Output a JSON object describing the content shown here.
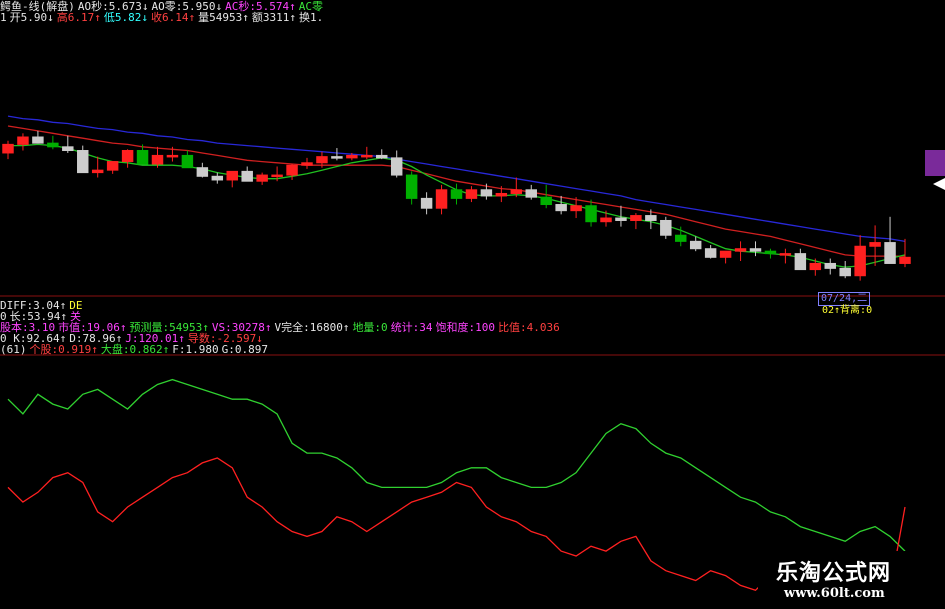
{
  "header": {
    "line1": [
      {
        "text": "鳄鱼-线(解盘)",
        "color": "#e6e6e6"
      },
      {
        "text": "AO秒:5.673↓",
        "color": "#e6e6e6"
      },
      {
        "text": "AO零:5.950↓",
        "color": "#e6e6e6"
      },
      {
        "text": "AC秒:5.574↑",
        "color": "#ff44ff"
      },
      {
        "text": "AC零",
        "color": "#39e639"
      }
    ],
    "line2": [
      {
        "text": "1",
        "color": "#e6e6e6"
      },
      {
        "text": "开5.90↓",
        "color": "#e6e6e6"
      },
      {
        "text": "高6.17↑",
        "color": "#ff4040"
      },
      {
        "text": "低5.82↓",
        "color": "#33ffff"
      },
      {
        "text": "收6.14↑",
        "color": "#ff4040"
      },
      {
        "text": "量54953↑",
        "color": "#e6e6e6"
      },
      {
        "text": "额3311↑",
        "color": "#e6e6e6"
      },
      {
        "text": "换1.",
        "color": "#e6e6e6"
      }
    ]
  },
  "indicators": {
    "line1": [
      {
        "text": "DIFF:3.04↑",
        "color": "#e6e6e6"
      },
      {
        "text": "DE",
        "color": "#ffff33"
      }
    ],
    "line2": [
      {
        "text": "0",
        "color": "#e6e6e6"
      },
      {
        "text": "长:53.94↑",
        "color": "#e6e6e6"
      },
      {
        "text": "关",
        "color": "#ff44ff"
      }
    ],
    "line3": [
      {
        "text": "股本:3.10",
        "color": "#ff44ff"
      },
      {
        "text": "市值:19.06↑",
        "color": "#ff44ff"
      },
      {
        "text": "预测量:54953↑",
        "color": "#39e639"
      },
      {
        "text": "VS:30278↑",
        "color": "#ff44ff"
      },
      {
        "text": "V完全:16800↑",
        "color": "#e6e6e6"
      },
      {
        "text": "地量:0",
        "color": "#39e639"
      },
      {
        "text": "统计:34",
        "color": "#ff44ff"
      },
      {
        "text": "饱和度:100",
        "color": "#ff44ff"
      },
      {
        "text": "比值:4.036",
        "color": "#ff4040"
      }
    ],
    "line4": [
      {
        "text": "0 K:92.64↑",
        "color": "#e6e6e6"
      },
      {
        "text": "D:78.96↑",
        "color": "#e6e6e6"
      },
      {
        "text": "J:120.01↑",
        "color": "#ff44ff"
      },
      {
        "text": "导数:-2.597↓",
        "color": "#ff4040"
      }
    ],
    "line5": [
      {
        "text": "(61)",
        "color": "#e6e6e6"
      },
      {
        "text": "个股:0.919↑",
        "color": "#ff4040"
      },
      {
        "text": "大盘:0.862↑",
        "color": "#39e639"
      },
      {
        "text": "F:1.980",
        "color": "#e6e6e6"
      },
      {
        "text": "G:0.897",
        "color": "#e6e6e6"
      }
    ]
  },
  "right_tags": {
    "date": "07/24,二",
    "divergence": "02↑背离:0"
  },
  "watermark": {
    "title": "乐淘公式网",
    "url": "www.60lt.com"
  },
  "colors": {
    "up": "#ff2020",
    "down_filled": "#00b000",
    "down_hollow": "#cccccc",
    "ma_blue": "#2828d8",
    "ma_red": "#d02020",
    "ma_green": "#20c020",
    "green_line": "#30d030",
    "red_line": "#ff2020"
  },
  "chart_data": [
    {
      "type": "candlestick",
      "index": [
        1,
        2,
        3,
        4,
        5,
        6,
        7,
        8,
        9,
        10,
        11,
        12,
        13,
        14,
        15,
        16,
        17,
        18,
        19,
        20,
        21,
        22,
        23,
        24,
        25,
        26,
        27,
        28,
        29,
        30,
        31,
        32,
        33,
        34,
        35,
        36,
        37,
        38,
        39,
        40,
        41,
        42,
        43,
        44,
        45,
        46,
        47,
        48,
        49,
        50,
        51,
        52,
        53,
        54,
        55,
        56,
        57,
        58,
        59,
        60,
        61
      ],
      "open": [
        6.9,
        6.97,
        7.03,
        6.98,
        6.95,
        6.92,
        6.74,
        6.76,
        6.83,
        6.92,
        6.81,
        6.88,
        6.88,
        6.78,
        6.71,
        6.68,
        6.75,
        6.67,
        6.72,
        6.72,
        6.8,
        6.82,
        6.87,
        6.86,
        6.88,
        6.88,
        6.86,
        6.72,
        6.53,
        6.45,
        6.6,
        6.53,
        6.6,
        6.55,
        6.57,
        6.6,
        6.54,
        6.48,
        6.43,
        6.47,
        6.34,
        6.37,
        6.35,
        6.39,
        6.35,
        6.23,
        6.18,
        6.12,
        6.05,
        6.1,
        6.12,
        6.1,
        6.08,
        6.08,
        5.95,
        6.0,
        5.96,
        5.9,
        6.14,
        6.17,
        6.0
      ],
      "high": [
        7.0,
        7.06,
        7.08,
        7.04,
        7.04,
        6.96,
        6.87,
        6.83,
        6.93,
        6.97,
        6.95,
        6.95,
        6.92,
        6.82,
        6.74,
        6.74,
        6.79,
        6.74,
        6.79,
        6.81,
        6.86,
        6.91,
        6.94,
        6.9,
        6.95,
        6.93,
        6.92,
        6.75,
        6.58,
        6.64,
        6.65,
        6.63,
        6.65,
        6.63,
        6.7,
        6.64,
        6.64,
        6.55,
        6.54,
        6.52,
        6.43,
        6.47,
        6.41,
        6.44,
        6.38,
        6.3,
        6.22,
        6.15,
        6.09,
        6.18,
        6.18,
        6.12,
        6.12,
        6.12,
        6.04,
        6.04,
        6.02,
        6.23,
        6.31,
        6.38,
        6.2
      ],
      "low": [
        6.85,
        6.92,
        6.98,
        6.93,
        6.9,
        6.8,
        6.7,
        6.73,
        6.78,
        6.85,
        6.78,
        6.83,
        6.83,
        6.7,
        6.65,
        6.62,
        6.69,
        6.64,
        6.67,
        6.68,
        6.77,
        6.78,
        6.84,
        6.84,
        6.85,
        6.85,
        6.7,
        6.48,
        6.4,
        6.4,
        6.48,
        6.5,
        6.52,
        6.5,
        6.54,
        6.52,
        6.45,
        6.4,
        6.37,
        6.3,
        6.3,
        6.3,
        6.28,
        6.28,
        6.2,
        6.14,
        6.1,
        6.04,
        6.0,
        6.02,
        6.06,
        6.04,
        6.0,
        5.96,
        5.9,
        5.91,
        5.88,
        5.86,
        5.98,
        6.06,
        5.97
      ],
      "close": [
        6.97,
        7.03,
        6.98,
        6.95,
        6.92,
        6.74,
        6.76,
        6.83,
        6.92,
        6.81,
        6.88,
        6.88,
        6.78,
        6.71,
        6.68,
        6.75,
        6.67,
        6.72,
        6.72,
        6.8,
        6.82,
        6.87,
        6.86,
        6.88,
        6.88,
        6.86,
        6.72,
        6.53,
        6.45,
        6.6,
        6.53,
        6.6,
        6.55,
        6.57,
        6.6,
        6.54,
        6.48,
        6.43,
        6.47,
        6.34,
        6.37,
        6.35,
        6.39,
        6.35,
        6.23,
        6.18,
        6.12,
        6.05,
        6.1,
        6.12,
        6.1,
        6.08,
        6.08,
        5.95,
        6.0,
        5.96,
        5.9,
        6.14,
        6.17,
        6.0,
        6.05
      ],
      "ma_blue": [
        7.2,
        7.18,
        7.17,
        7.15,
        7.14,
        7.12,
        7.1,
        7.09,
        7.07,
        7.06,
        7.04,
        7.03,
        7.01,
        7.0,
        6.98,
        6.97,
        6.96,
        6.95,
        6.94,
        6.93,
        6.92,
        6.91,
        6.9,
        6.89,
        6.88,
        6.87,
        6.85,
        6.83,
        6.81,
        6.79,
        6.77,
        6.75,
        6.73,
        6.71,
        6.69,
        6.67,
        6.65,
        6.63,
        6.61,
        6.59,
        6.57,
        6.55,
        6.52,
        6.5,
        6.48,
        6.46,
        6.44,
        6.42,
        6.4,
        6.38,
        6.36,
        6.34,
        6.32,
        6.3,
        6.28,
        6.26,
        6.24,
        6.22,
        6.21,
        6.2,
        6.18
      ],
      "ma_red": [
        7.12,
        7.1,
        7.08,
        7.06,
        7.04,
        7.02,
        7.0,
        6.98,
        6.97,
        6.95,
        6.94,
        6.93,
        6.92,
        6.9,
        6.88,
        6.86,
        6.84,
        6.83,
        6.82,
        6.81,
        6.8,
        6.8,
        6.8,
        6.8,
        6.8,
        6.8,
        6.79,
        6.76,
        6.73,
        6.7,
        6.67,
        6.65,
        6.63,
        6.61,
        6.6,
        6.58,
        6.56,
        6.54,
        6.52,
        6.5,
        6.48,
        6.46,
        6.44,
        6.42,
        6.4,
        6.37,
        6.34,
        6.31,
        6.28,
        6.26,
        6.24,
        6.22,
        6.19,
        6.16,
        6.13,
        6.1,
        6.07,
        6.06,
        6.06,
        6.06,
        6.06
      ],
      "ma_green": [
        6.96,
        6.96,
        6.97,
        6.96,
        6.94,
        6.9,
        6.86,
        6.83,
        6.82,
        6.8,
        6.8,
        6.8,
        6.79,
        6.77,
        6.74,
        6.72,
        6.7,
        6.69,
        6.69,
        6.71,
        6.73,
        6.76,
        6.79,
        6.82,
        6.84,
        6.86,
        6.84,
        6.79,
        6.72,
        6.66,
        6.6,
        6.56,
        6.55,
        6.55,
        6.56,
        6.55,
        6.53,
        6.5,
        6.47,
        6.44,
        6.41,
        6.38,
        6.36,
        6.34,
        6.31,
        6.27,
        6.22,
        6.17,
        6.12,
        6.1,
        6.09,
        6.08,
        6.07,
        6.05,
        6.02,
        5.99,
        5.97,
        5.98,
        6.01,
        6.04,
        6.07
      ],
      "ylim": [
        5.8,
        7.25
      ]
    },
    {
      "type": "line",
      "series": [
        {
          "color": "#30d030",
          "values": [
            84,
            78,
            86,
            82,
            80,
            86,
            88,
            84,
            80,
            86,
            90,
            92,
            90,
            88,
            86,
            84,
            84,
            82,
            78,
            66,
            62,
            62,
            60,
            56,
            50,
            48,
            48,
            48,
            48,
            50,
            54,
            56,
            56,
            52,
            50,
            48,
            48,
            50,
            54,
            62,
            70,
            74,
            72,
            66,
            62,
            60,
            56,
            52,
            48,
            44,
            42,
            38,
            36,
            32,
            30,
            28,
            26,
            30,
            32,
            28,
            22
          ]
        },
        {
          "color": "#ff2020",
          "values": [
            48,
            42,
            46,
            52,
            54,
            50,
            38,
            34,
            40,
            44,
            48,
            52,
            54,
            58,
            60,
            56,
            44,
            40,
            34,
            30,
            28,
            30,
            36,
            34,
            30,
            34,
            38,
            42,
            44,
            46,
            50,
            48,
            40,
            36,
            34,
            30,
            28,
            22,
            20,
            24,
            22,
            26,
            28,
            18,
            14,
            12,
            10,
            14,
            12,
            8,
            6,
            12,
            8,
            4,
            2,
            12,
            16,
            12,
            8,
            6,
            40
          ]
        }
      ],
      "ylim": [
        0,
        100
      ]
    }
  ]
}
